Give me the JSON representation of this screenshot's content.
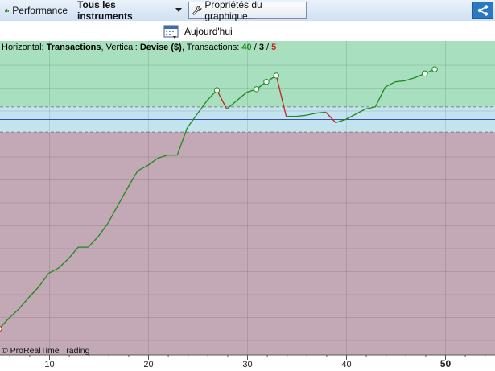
{
  "toolbar": {
    "performance_label": "Performance",
    "instruments_label": "Tous les instruments",
    "properties_label": "Propriétés du graphique...",
    "icons": [
      "chart-bar-icon",
      "wrench-icon",
      "share-icon"
    ]
  },
  "subbar": {
    "today_label": "Aujourd'hui",
    "icon": "calendar-icon"
  },
  "info": {
    "horizontal_label": "Horizontal:",
    "horizontal_value": "Transactions",
    "vertical_label": "Vertical:",
    "vertical_value": "Devise ($)",
    "transactions_label": "Transactions:",
    "transactions_total": "40",
    "transactions_mid": "3",
    "transactions_losing": "5",
    "sep": "/"
  },
  "copyright": "© ProRealTime Trading",
  "colors": {
    "profit_zone": "#a7dfbf",
    "neutral_zone": "#c3e3ef",
    "loss_zone": "#c2a9b5",
    "line_up": "#1e8a1e",
    "line_down": "#c62020",
    "baseline": "#3c4fa8"
  },
  "chart_data": {
    "type": "line",
    "x_ticks": [
      "10",
      "20",
      "30",
      "40",
      "50"
    ],
    "xlim": [
      5,
      55
    ],
    "grid": true,
    "points": [
      {
        "x": 0,
        "y": 0.6,
        "marker": true
      },
      {
        "x": 1,
        "y": 1.55,
        "marker": true
      },
      {
        "x": 2,
        "y": 1.8,
        "marker": true
      },
      {
        "x": 3,
        "y": 0.0,
        "marker": true
      },
      {
        "x": 4,
        "y": -20.0,
        "marker": true
      },
      {
        "x": 5,
        "y": -19.0
      },
      {
        "x": 6,
        "y": -18.1
      },
      {
        "x": 7,
        "y": -17.0
      },
      {
        "x": 8,
        "y": -16.0
      },
      {
        "x": 9,
        "y": -14.7
      },
      {
        "x": 10,
        "y": -14.2
      },
      {
        "x": 11,
        "y": -13.3
      },
      {
        "x": 12,
        "y": -12.2
      },
      {
        "x": 13,
        "y": -12.2
      },
      {
        "x": 14,
        "y": -11.2
      },
      {
        "x": 15,
        "y": -9.9
      },
      {
        "x": 16,
        "y": -8.2
      },
      {
        "x": 17,
        "y": -6.5
      },
      {
        "x": 18,
        "y": -4.9
      },
      {
        "x": 19,
        "y": -4.4
      },
      {
        "x": 20,
        "y": -3.7
      },
      {
        "x": 21,
        "y": -3.4
      },
      {
        "x": 22,
        "y": -3.4
      },
      {
        "x": 23,
        "y": -0.8
      },
      {
        "x": 24,
        "y": 0.5
      },
      {
        "x": 25,
        "y": 1.8
      },
      {
        "x": 26,
        "y": 2.8,
        "marker": true
      },
      {
        "x": 27,
        "y": 1.0
      },
      {
        "x": 28,
        "y": 1.8
      },
      {
        "x": 29,
        "y": 2.6
      },
      {
        "x": 30,
        "y": 2.9,
        "marker": true
      },
      {
        "x": 31,
        "y": 3.6,
        "marker": true
      },
      {
        "x": 32,
        "y": 4.2,
        "marker": true
      },
      {
        "x": 33,
        "y": 0.3
      },
      {
        "x": 34,
        "y": 0.3
      },
      {
        "x": 35,
        "y": 0.4
      },
      {
        "x": 36,
        "y": 0.6
      },
      {
        "x": 37,
        "y": 0.7
      },
      {
        "x": 38,
        "y": -0.3
      },
      {
        "x": 39,
        "y": 0.0
      },
      {
        "x": 40,
        "y": 0.5
      },
      {
        "x": 41,
        "y": 1.0
      },
      {
        "x": 42,
        "y": 1.2
      },
      {
        "x": 43,
        "y": 3.1
      },
      {
        "x": 44,
        "y": 3.6
      },
      {
        "x": 45,
        "y": 3.7
      },
      {
        "x": 46,
        "y": 4.0
      },
      {
        "x": 47,
        "y": 4.4,
        "marker": true
      },
      {
        "x": 48,
        "y": 4.8,
        "marker": true
      }
    ],
    "zones": {
      "profit_above": 1.2,
      "loss_below": -1.2
    },
    "baseline": 0,
    "ylim": [
      -22.5,
      7.5
    ]
  }
}
